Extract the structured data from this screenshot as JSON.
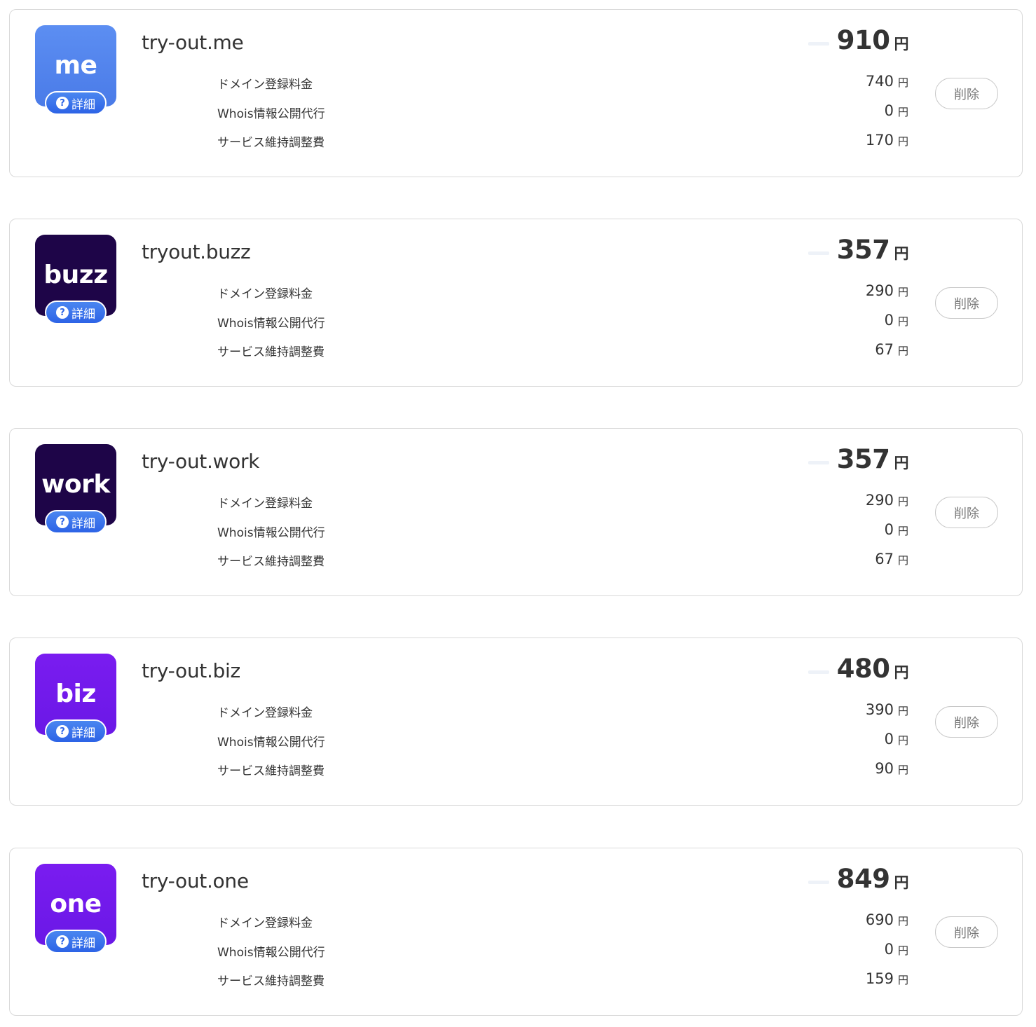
{
  "detail_label": "詳細",
  "help_glyph": "?",
  "delete_label": "削除",
  "yen": "円",
  "fee_labels": {
    "registration": "ドメイン登録料金",
    "whois": "Whois情報公開代行",
    "service": "サービス維持調整費"
  },
  "items": [
    {
      "tld": "me",
      "domain": "try-out.me",
      "total": "910",
      "registration": "740",
      "whois": "0",
      "service": "170",
      "icon_color_top": "#5c8ef2",
      "icon_color_bottom": "#4a7be8"
    },
    {
      "tld": "buzz",
      "domain": "tryout.buzz",
      "total": "357",
      "registration": "290",
      "whois": "0",
      "service": "67",
      "icon_color_top": "#1e0548",
      "icon_color_bottom": "#1e0548"
    },
    {
      "tld": "work",
      "domain": "try-out.work",
      "total": "357",
      "registration": "290",
      "whois": "0",
      "service": "67",
      "icon_color_top": "#1e0548",
      "icon_color_bottom": "#1e0548"
    },
    {
      "tld": "biz",
      "domain": "try-out.biz",
      "total": "480",
      "registration": "390",
      "whois": "0",
      "service": "90",
      "icon_color_top": "#7a1cf0",
      "icon_color_bottom": "#6a18e6"
    },
    {
      "tld": "one",
      "domain": "try-out.one",
      "total": "849",
      "registration": "690",
      "whois": "0",
      "service": "159",
      "icon_color_top": "#7a1cf0",
      "icon_color_bottom": "#6a18e6"
    }
  ]
}
